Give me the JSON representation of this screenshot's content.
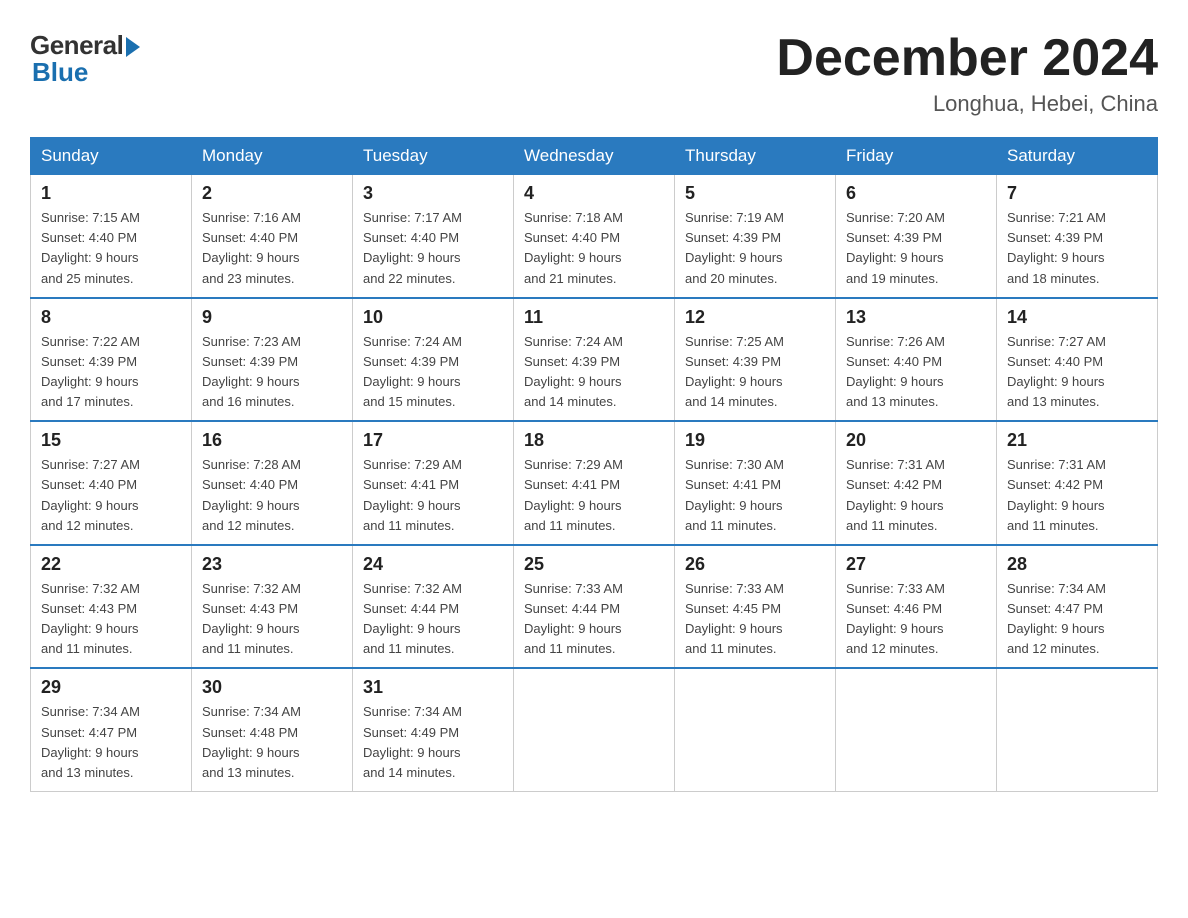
{
  "header": {
    "logo": {
      "general": "General",
      "blue": "Blue"
    },
    "title": "December 2024",
    "location": "Longhua, Hebei, China"
  },
  "days_of_week": [
    "Sunday",
    "Monday",
    "Tuesday",
    "Wednesday",
    "Thursday",
    "Friday",
    "Saturday"
  ],
  "weeks": [
    [
      {
        "day": "1",
        "sunrise": "7:15 AM",
        "sunset": "4:40 PM",
        "daylight": "9 hours and 25 minutes."
      },
      {
        "day": "2",
        "sunrise": "7:16 AM",
        "sunset": "4:40 PM",
        "daylight": "9 hours and 23 minutes."
      },
      {
        "day": "3",
        "sunrise": "7:17 AM",
        "sunset": "4:40 PM",
        "daylight": "9 hours and 22 minutes."
      },
      {
        "day": "4",
        "sunrise": "7:18 AM",
        "sunset": "4:40 PM",
        "daylight": "9 hours and 21 minutes."
      },
      {
        "day": "5",
        "sunrise": "7:19 AM",
        "sunset": "4:39 PM",
        "daylight": "9 hours and 20 minutes."
      },
      {
        "day": "6",
        "sunrise": "7:20 AM",
        "sunset": "4:39 PM",
        "daylight": "9 hours and 19 minutes."
      },
      {
        "day": "7",
        "sunrise": "7:21 AM",
        "sunset": "4:39 PM",
        "daylight": "9 hours and 18 minutes."
      }
    ],
    [
      {
        "day": "8",
        "sunrise": "7:22 AM",
        "sunset": "4:39 PM",
        "daylight": "9 hours and 17 minutes."
      },
      {
        "day": "9",
        "sunrise": "7:23 AM",
        "sunset": "4:39 PM",
        "daylight": "9 hours and 16 minutes."
      },
      {
        "day": "10",
        "sunrise": "7:24 AM",
        "sunset": "4:39 PM",
        "daylight": "9 hours and 15 minutes."
      },
      {
        "day": "11",
        "sunrise": "7:24 AM",
        "sunset": "4:39 PM",
        "daylight": "9 hours and 14 minutes."
      },
      {
        "day": "12",
        "sunrise": "7:25 AM",
        "sunset": "4:39 PM",
        "daylight": "9 hours and 14 minutes."
      },
      {
        "day": "13",
        "sunrise": "7:26 AM",
        "sunset": "4:40 PM",
        "daylight": "9 hours and 13 minutes."
      },
      {
        "day": "14",
        "sunrise": "7:27 AM",
        "sunset": "4:40 PM",
        "daylight": "9 hours and 13 minutes."
      }
    ],
    [
      {
        "day": "15",
        "sunrise": "7:27 AM",
        "sunset": "4:40 PM",
        "daylight": "9 hours and 12 minutes."
      },
      {
        "day": "16",
        "sunrise": "7:28 AM",
        "sunset": "4:40 PM",
        "daylight": "9 hours and 12 minutes."
      },
      {
        "day": "17",
        "sunrise": "7:29 AM",
        "sunset": "4:41 PM",
        "daylight": "9 hours and 11 minutes."
      },
      {
        "day": "18",
        "sunrise": "7:29 AM",
        "sunset": "4:41 PM",
        "daylight": "9 hours and 11 minutes."
      },
      {
        "day": "19",
        "sunrise": "7:30 AM",
        "sunset": "4:41 PM",
        "daylight": "9 hours and 11 minutes."
      },
      {
        "day": "20",
        "sunrise": "7:31 AM",
        "sunset": "4:42 PM",
        "daylight": "9 hours and 11 minutes."
      },
      {
        "day": "21",
        "sunrise": "7:31 AM",
        "sunset": "4:42 PM",
        "daylight": "9 hours and 11 minutes."
      }
    ],
    [
      {
        "day": "22",
        "sunrise": "7:32 AM",
        "sunset": "4:43 PM",
        "daylight": "9 hours and 11 minutes."
      },
      {
        "day": "23",
        "sunrise": "7:32 AM",
        "sunset": "4:43 PM",
        "daylight": "9 hours and 11 minutes."
      },
      {
        "day": "24",
        "sunrise": "7:32 AM",
        "sunset": "4:44 PM",
        "daylight": "9 hours and 11 minutes."
      },
      {
        "day": "25",
        "sunrise": "7:33 AM",
        "sunset": "4:44 PM",
        "daylight": "9 hours and 11 minutes."
      },
      {
        "day": "26",
        "sunrise": "7:33 AM",
        "sunset": "4:45 PM",
        "daylight": "9 hours and 11 minutes."
      },
      {
        "day": "27",
        "sunrise": "7:33 AM",
        "sunset": "4:46 PM",
        "daylight": "9 hours and 12 minutes."
      },
      {
        "day": "28",
        "sunrise": "7:34 AM",
        "sunset": "4:47 PM",
        "daylight": "9 hours and 12 minutes."
      }
    ],
    [
      {
        "day": "29",
        "sunrise": "7:34 AM",
        "sunset": "4:47 PM",
        "daylight": "9 hours and 13 minutes."
      },
      {
        "day": "30",
        "sunrise": "7:34 AM",
        "sunset": "4:48 PM",
        "daylight": "9 hours and 13 minutes."
      },
      {
        "day": "31",
        "sunrise": "7:34 AM",
        "sunset": "4:49 PM",
        "daylight": "9 hours and 14 minutes."
      },
      null,
      null,
      null,
      null
    ]
  ],
  "labels": {
    "sunrise": "Sunrise:",
    "sunset": "Sunset:",
    "daylight": "Daylight:"
  }
}
